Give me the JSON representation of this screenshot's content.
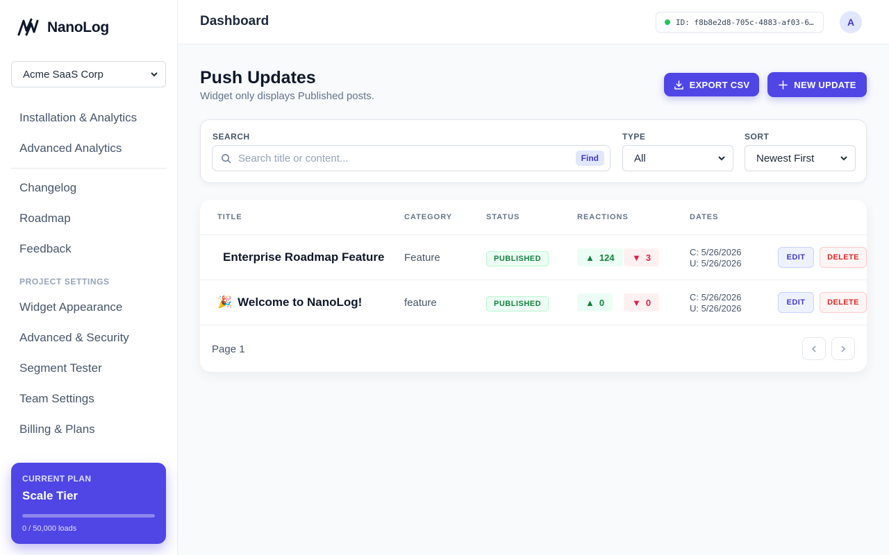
{
  "app": {
    "name": "NanoLog"
  },
  "sidebar": {
    "org_select": "Acme SaaS Corp",
    "nav_top": [
      "Installation & Analytics",
      "Advanced Analytics"
    ],
    "nav_main": [
      "Changelog",
      "Roadmap",
      "Feedback"
    ],
    "section_label": "PROJECT SETTINGS",
    "nav_settings": [
      "Widget Appearance",
      "Advanced & Security",
      "Segment Tester",
      "Team Settings",
      "Billing & Plans"
    ],
    "plan": {
      "label": "CURRENT PLAN",
      "name": "Scale Tier",
      "usage": "0 / 50,000 loads",
      "progress_fraction": 0
    }
  },
  "header": {
    "title": "Dashboard",
    "project_id": "ID: f8b8e2d8-705c-4883-af03-6…",
    "avatar_initial": "A"
  },
  "main": {
    "title": "Push Updates",
    "subtitle": "Widget only displays Published posts.",
    "export_label": "EXPORT CSV",
    "new_label": "NEW UPDATE",
    "filters": {
      "search_label": "SEARCH",
      "search_placeholder": "Search title or content...",
      "find_label": "Find",
      "type_label": "TYPE",
      "type_value": "All",
      "sort_label": "SORT",
      "sort_value": "Newest First"
    },
    "table": {
      "headers": [
        "TITLE",
        "CATEGORY",
        "STATUS",
        "REACTIONS",
        "DATES"
      ],
      "rows": [
        {
          "emoji": "",
          "title": "Enterprise Roadmap Feature",
          "category": "Feature",
          "status": "PUBLISHED",
          "up": "124",
          "down": "3",
          "created": "C: 5/26/2026",
          "updated": "U: 5/26/2026",
          "edit": "EDIT",
          "delete": "DELETE"
        },
        {
          "emoji": "🎉",
          "title": "Welcome to NanoLog!",
          "category": "feature",
          "status": "PUBLISHED",
          "up": "0",
          "down": "0",
          "created": "C: 5/26/2026",
          "updated": "U: 5/26/2026",
          "edit": "EDIT",
          "delete": "DELETE"
        }
      ],
      "page_label": "Page 1"
    }
  },
  "colors": {
    "accent": "#4f46e5",
    "success": "#15803d",
    "danger": "#dc2626",
    "online": "#22c55e"
  }
}
